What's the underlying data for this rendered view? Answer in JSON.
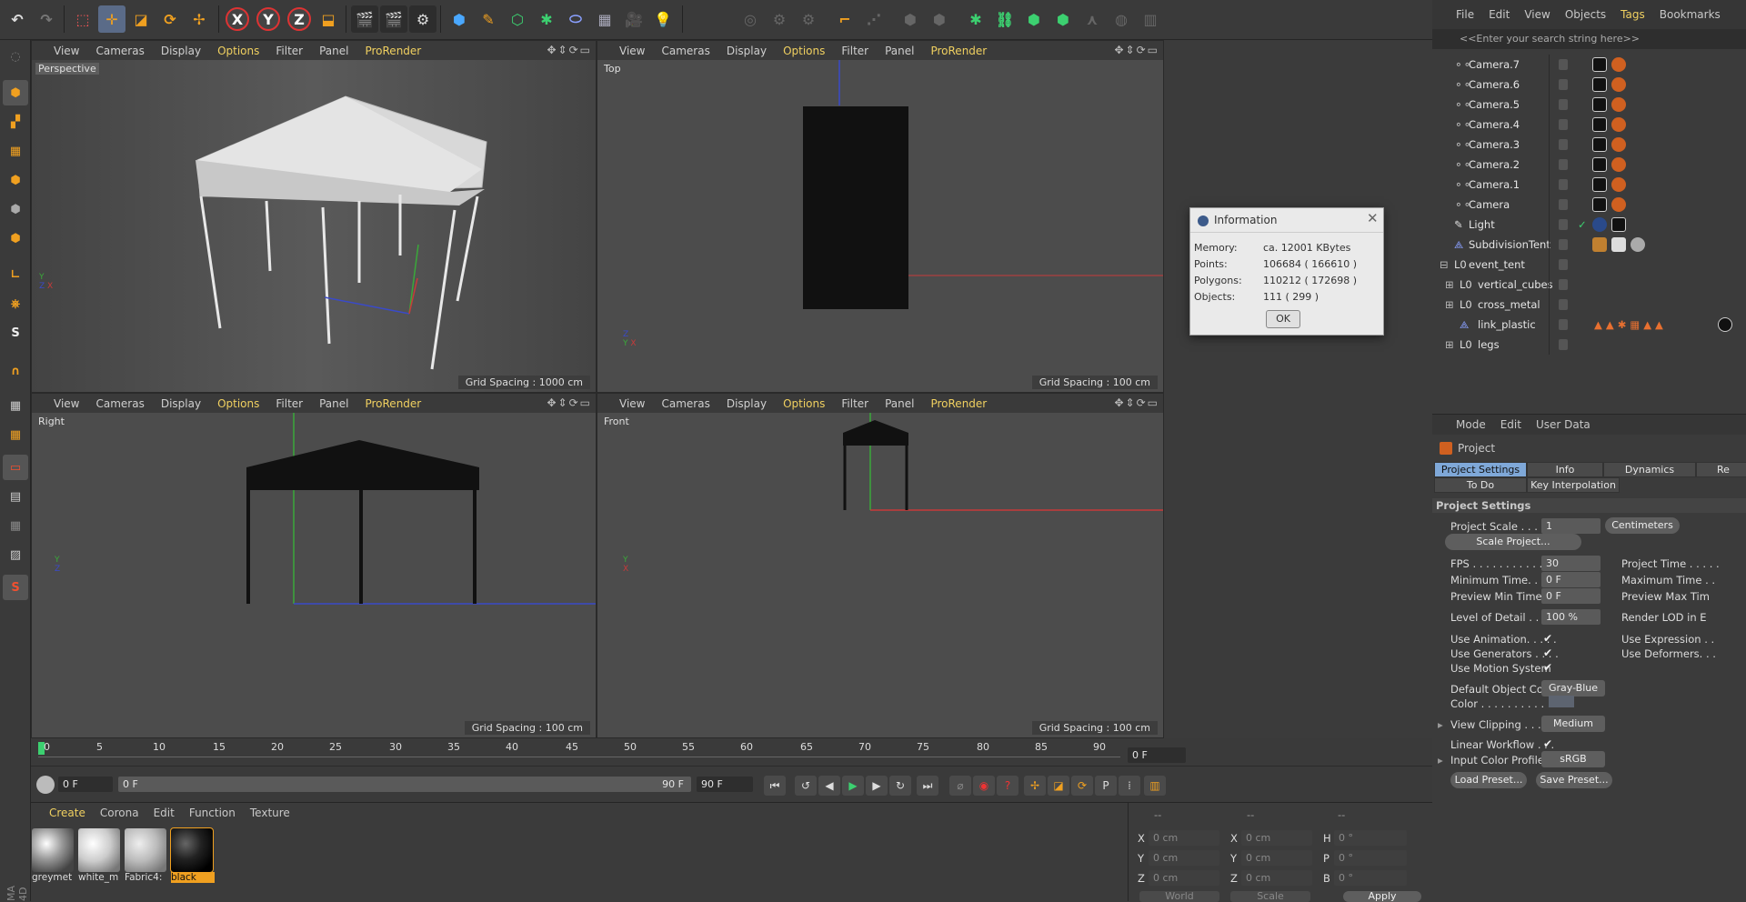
{
  "viewport_menu": [
    "View",
    "Cameras",
    "Display",
    "Options",
    "Filter",
    "Panel",
    "ProRender"
  ],
  "viewports": [
    {
      "name": "Perspective",
      "grid": "Grid Spacing : 1000 cm"
    },
    {
      "name": "Top",
      "grid": "Grid Spacing : 100 cm"
    },
    {
      "name": "Right",
      "grid": "Grid Spacing : 100 cm"
    },
    {
      "name": "Front",
      "grid": "Grid Spacing : 100 cm"
    }
  ],
  "info_dialog": {
    "title": "Information",
    "rows": [
      {
        "label": "Memory:",
        "value": "ca. 12001 KBytes"
      },
      {
        "label": "Points:",
        "value": "106684 ( 166610 )"
      },
      {
        "label": "Polygons:",
        "value": "110212 ( 172698 )"
      },
      {
        "label": "Objects:",
        "value": "111 ( 299 )"
      }
    ],
    "ok": "OK"
  },
  "object_manager": {
    "menu": [
      "File",
      "Edit",
      "View",
      "Objects",
      "Tags",
      "Bookmarks"
    ],
    "search_placeholder": "<<Enter your search string here>>",
    "objects": [
      "Camera.7",
      "Camera.6",
      "Camera.5",
      "Camera.4",
      "Camera.3",
      "Camera.2",
      "Camera.1",
      "Camera",
      "Light",
      "SubdivisionTent",
      "event_tent",
      "vertical_cubes",
      "cross_metal",
      "link_plastic",
      "legs"
    ]
  },
  "attributes": {
    "menu": [
      "Mode",
      "Edit",
      "User Data"
    ],
    "title": "Project",
    "tabs": [
      "Project Settings",
      "Info",
      "Dynamics",
      "Re",
      "To Do",
      "Key Interpolation"
    ],
    "section": "Project Settings",
    "project_scale_label": "Project Scale . . . . . .",
    "project_scale_value": "1",
    "project_scale_unit": "Centimeters",
    "scale_project_btn": "Scale Project...",
    "fps_label": "FPS . . . . . . . . . . . . . .",
    "fps_value": "30",
    "min_time_label": "Minimum Time. . . .",
    "min_time_value": "0 F",
    "preview_min_label": "Preview Min Time . .",
    "preview_min_value": "0 F",
    "lod_label": "Level of Detail . . . . .",
    "lod_value": "100 %",
    "project_time_label": "Project Time . . . . .",
    "max_time_label": "Maximum Time . .",
    "preview_max_label": "Preview Max Tim",
    "render_lod_label": "Render LOD in E",
    "use_animation": "Use Animation. . . . .",
    "use_generators": "Use Generators . . . .",
    "use_motion": "Use Motion System",
    "use_expression": "Use Expression . .",
    "use_deformers": "Use Deformers. . .",
    "default_color_label": "Default Object Color",
    "default_color_value": "Gray-Blue",
    "color_label": "Color . . . . . . . . . . .",
    "view_clipping_label": "View Clipping . . . . .",
    "view_clipping_value": "Medium",
    "linear_workflow": "Linear Workflow . . .",
    "input_color_label": "Input Color Profile . .",
    "input_color_value": "sRGB",
    "load_preset": "Load Preset...",
    "save_preset": "Save Preset..."
  },
  "timeline": {
    "ticks": [
      "0",
      "5",
      "10",
      "15",
      "20",
      "25",
      "30",
      "35",
      "40",
      "45",
      "50",
      "55",
      "60",
      "65",
      "70",
      "75",
      "80",
      "85",
      "90"
    ],
    "current_frame": "0 F",
    "start_field": "0 F",
    "range_start": "0 F",
    "range_end": "90 F",
    "end_field": "90 F"
  },
  "materials": {
    "menu": [
      "Create",
      "Corona",
      "Edit",
      "Function",
      "Texture"
    ],
    "items": [
      {
        "label": "greymet"
      },
      {
        "label": "white_m"
      },
      {
        "label": "Fabric4:"
      },
      {
        "label": "black"
      }
    ]
  },
  "coordinates": {
    "headers": [
      "--",
      "--",
      "--"
    ],
    "rows": [
      {
        "a": "X",
        "av": "0 cm",
        "b": "X",
        "bv": "0 cm",
        "c": "H",
        "cv": "0 °"
      },
      {
        "a": "Y",
        "av": "0 cm",
        "b": "Y",
        "bv": "0 cm",
        "c": "P",
        "cv": "0 °"
      },
      {
        "a": "Z",
        "av": "0 cm",
        "b": "Z",
        "bv": "0 cm",
        "c": "B",
        "cv": "0 °"
      }
    ],
    "world": "World",
    "scale": "Scale",
    "apply": "Apply"
  },
  "brand_vertical": "MA 4D",
  "colors": {
    "accent_yellow": "#f0d060",
    "tab_active": "#7fa8d8",
    "x_axis": "#c83a3a",
    "y_axis": "#3aa83a",
    "z_axis": "#3a4ac8"
  }
}
